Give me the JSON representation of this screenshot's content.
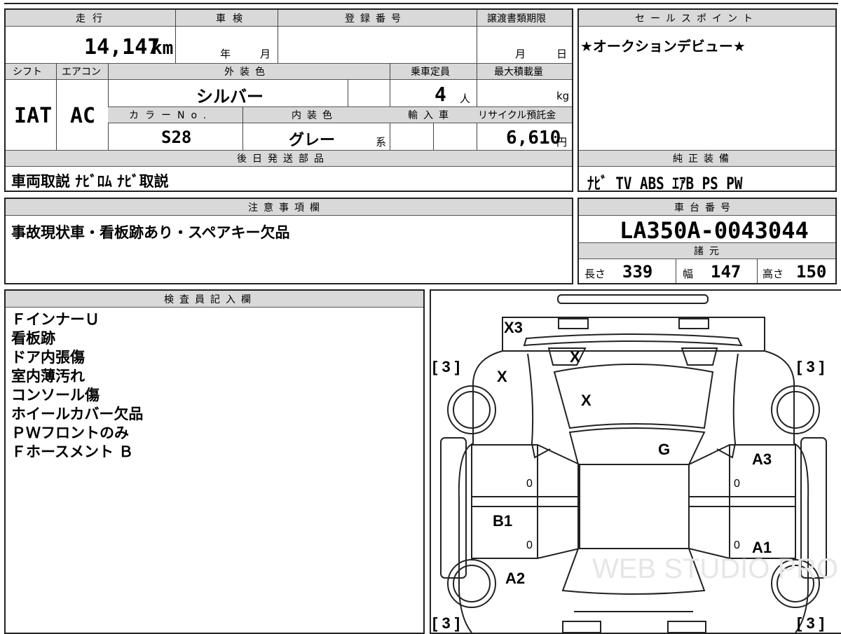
{
  "vehicle": {
    "mileage_label": "走行",
    "mileage_value": "14,147",
    "mileage_unit": "km",
    "inspection_label": "車検",
    "inspection_year_unit": "年",
    "inspection_month_unit": "月",
    "registration_label": "登録番号",
    "transfer_deadline_label": "譲渡書類期限",
    "transfer_month_unit": "月",
    "transfer_day_unit": "日",
    "shift_label": "シフト",
    "shift_value": "IAT",
    "ac_label": "エアコン",
    "ac_value": "AC",
    "exterior_color_label": "外装色",
    "exterior_color_value": "シルバー",
    "capacity_label": "乗車定員",
    "capacity_value": "4",
    "capacity_unit": "人",
    "max_load_label": "最大積載量",
    "max_load_unit": "kg",
    "color_no_label": "カラーNo.",
    "color_no_value": "S28",
    "interior_color_label": "内装色",
    "interior_color_value": "グレー",
    "interior_color_suffix": "系",
    "import_label": "輸入車",
    "recycle_label": "リサイクル預託金",
    "recycle_value": "6,610",
    "recycle_unit": "円",
    "later_parts_label": "後日発送部品",
    "later_parts_value": "車両取説 ﾅﾋﾞﾛﾑ ﾅﾋﾞ取説"
  },
  "sales_point": {
    "label": "セールスポイント",
    "value": "★オークションデビュー★"
  },
  "equipment": {
    "label": "純正装備",
    "value": "ﾅﾋﾞ TV ABS ｴｱB PS PW"
  },
  "caution": {
    "label": "注意事項欄",
    "value": "事故現状車・看板跡あり・スペアキー欠品"
  },
  "chassis": {
    "label": "車台番号",
    "value": "LA350A-0043044"
  },
  "specs": {
    "label": "諸元",
    "length_label": "長さ",
    "length_value": "339",
    "width_label": "幅",
    "width_value": "147",
    "height_label": "高さ",
    "height_value": "150"
  },
  "inspector": {
    "label": "検査員記入欄",
    "notes": [
      "ＦインナーＵ",
      "看板跡",
      "ドア内張傷",
      "室内薄汚れ",
      "コンソール傷",
      "ホイールカバー欠品",
      "ＰＷフロントのみ",
      "Ｆホースメント Ｂ"
    ]
  },
  "diagram": {
    "marks": {
      "front_top": "X3",
      "hood_left": "X",
      "windshield_top": "X",
      "windshield": "X",
      "roof_right": "G",
      "front_door_right": "A3",
      "rear_door_left": "B1",
      "rear_door_right": "A1",
      "rear_left": "A2"
    },
    "tire_left_front": "[ 3 ]",
    "tire_right_front": "[ 3 ]",
    "tire_left_rear": "[ 3 ]",
    "tire_right_rear": "[ 3 ]",
    "zeros": [
      "0",
      "0",
      "0",
      "0"
    ],
    "watermark": "WEB STUDIO PRO"
  }
}
